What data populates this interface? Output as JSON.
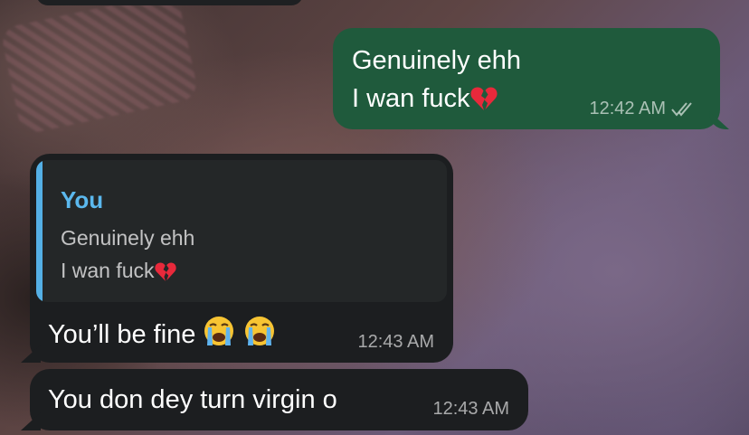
{
  "chat": {
    "outgoing": {
      "line1": "Genuinely ehh",
      "line2": "I wan fuck",
      "line2_emoji": "broken-heart",
      "time": "12:42 AM",
      "status_icon": "double-check-icon"
    },
    "reply_message": {
      "quote": {
        "author": "You",
        "line1": "Genuinely ehh",
        "line2": "I wan fuck",
        "line2_emoji": "broken-heart"
      },
      "text": "You’ll be fine",
      "emojis": [
        "loudly-crying-face",
        "loudly-crying-face"
      ],
      "time": "12:43 AM"
    },
    "last_message": {
      "text": "You don dey turn virgin o",
      "time": "12:43 AM"
    }
  },
  "colors": {
    "outgoing_bubble": "#1f5a3c",
    "incoming_bubble": "#1c1e20",
    "quote_accent": "#54b0e6"
  }
}
